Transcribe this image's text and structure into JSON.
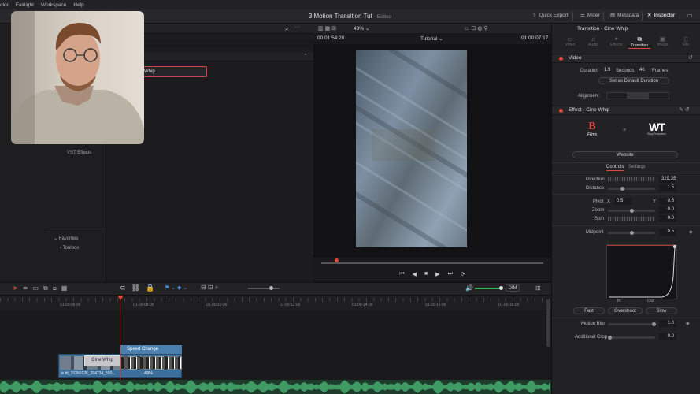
{
  "menubar": {
    "items": [
      "olor",
      "Fairlight",
      "Workspace",
      "Help"
    ]
  },
  "project": {
    "title": "3 Motion Transition Tut",
    "status": "Edited"
  },
  "topbar": {
    "quick_export": "Quick Export",
    "mixer": "Mixer",
    "metadata": "Metadata",
    "inspector": "Inspector"
  },
  "media": {
    "selected_effect": "Whip",
    "vst_effects": "VST Effects",
    "favorites": "Favorites",
    "toolbox": "Toolbox"
  },
  "viewer": {
    "timecode_left": "00:01:54:20",
    "zoom": "43%",
    "timeline_name": "Tutorial",
    "timecode_right": "01:00:07:17"
  },
  "inspector": {
    "title": "Transition - Cine Whip",
    "tabs": [
      "Video",
      "Audio",
      "Effects",
      "Transition",
      "Image",
      "File"
    ],
    "active_tab": "Transition",
    "video_section": "Video",
    "duration_label": "Duration",
    "duration_seconds": "1.9",
    "seconds_label": "Seconds",
    "duration_frames": "46",
    "frames_label": "Frames",
    "set_default": "Set as Default Duration",
    "alignment_label": "Alignment",
    "effect_section": "Effect - Cine Whip",
    "brand_left": "Films",
    "brand_x": "×",
    "brand_right": "WippTemplates",
    "website": "Website",
    "controls_tab": "Controls",
    "settings_tab": "Settings",
    "direction_label": "Direction",
    "direction_value": "329.35",
    "distance_label": "Distance",
    "distance_value": "1.5",
    "pivot_label": "Pivot",
    "pivot_x_label": "X",
    "pivot_x": "0.5",
    "pivot_y_label": "Y",
    "pivot_y": "0.5",
    "zoom_label": "Zoom",
    "zoom_value": "0.0",
    "spin_label": "Spin",
    "spin_value": "0.0",
    "midpoint_label": "Midpoint",
    "midpoint_value": "0.5",
    "in_label": "In",
    "out_label": "Out",
    "fast": "Fast",
    "overshoot": "Overshoot",
    "slow": "Slow",
    "motion_blur_label": "Motion Blur",
    "motion_blur_value": "1.0",
    "additional_crop_label": "Additional Crop",
    "additional_crop_value": "0.0"
  },
  "timeline": {
    "dim": "DIM",
    "ruler": [
      "01:00:06:00",
      "01:00:08:00",
      "01:00:10:00",
      "01:00:12:00",
      "01:00:14:00",
      "01:00:16:00",
      "01:00:18:00"
    ],
    "clip_transition": "Cine Whip",
    "clip_speed": "Speed Change",
    "clip_name": "hf_20260126_204734_550...",
    "clip_speed_value": "49%"
  },
  "colors": {
    "accent_red": "#e0473c",
    "clip_blue": "#3c6f9c",
    "audio_green": "#2e6b49"
  }
}
